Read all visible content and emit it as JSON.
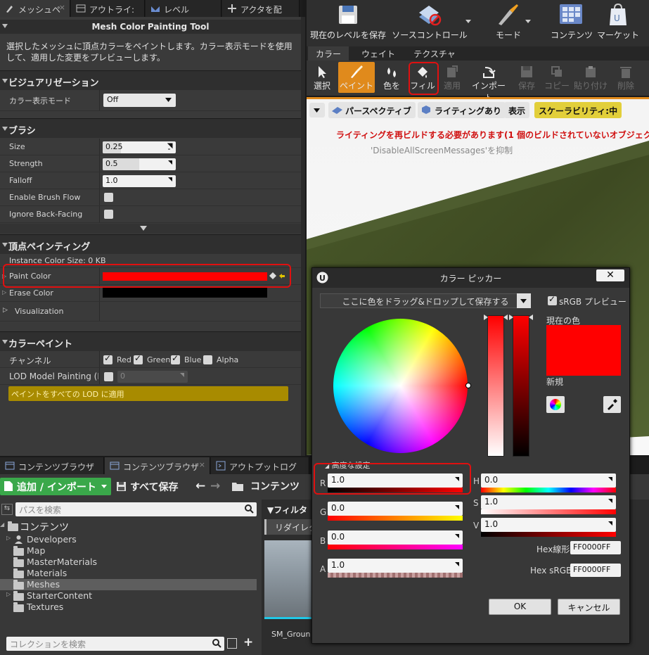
{
  "left_tabs": [
    {
      "label": "メッシュペ",
      "icon": "paint-brush-icon"
    },
    {
      "label": "アウトライ:",
      "icon": "outliner-icon"
    },
    {
      "label": "レベル",
      "icon": "level-icon"
    },
    {
      "label": "アクタを配",
      "icon": "place-actor-icon"
    }
  ],
  "tool": {
    "title": "Mesh Color Painting Tool",
    "description_line1": "選択したメッシュに頂点カラーをペイントします。カラー表示モードを使用",
    "description_line2": "して、適用した変更をプレビューします。"
  },
  "visualization": {
    "header": "ビジュアリゼーション",
    "color_view_label": "カラー表示モード",
    "color_view_value": "Off"
  },
  "brush": {
    "header": "ブラシ",
    "size_label": "Size",
    "size_value": "0.25",
    "strength_label": "Strength",
    "strength_value": "0.5",
    "falloff_label": "Falloff",
    "falloff_value": "1.0",
    "flow_label": "Enable Brush Flow",
    "backface_label": "Ignore Back-Facing"
  },
  "vertex": {
    "header": "頂点ペインティング",
    "instance_size": "Instance Color Size: 0 KB",
    "paint_color_label": "Paint Color",
    "paint_color": "#ff0000",
    "erase_color_label": "Erase Color",
    "erase_color": "#000000",
    "visualization_label": "Visualization"
  },
  "color_paint": {
    "header": "カラーペイント",
    "channel_label": "チャンネル",
    "channels": [
      "Red",
      "Green",
      "Blue",
      "Alpha"
    ],
    "lod_label": "LOD Model Painting (LO",
    "lod_value": "0",
    "apply_all_lod": "ペイントをすべての LOD に適用"
  },
  "top_toolbar": [
    {
      "label": "現在のレベルを保存",
      "icon": "save-disk-icon"
    },
    {
      "label": "ソースコントロール",
      "icon": "source-control-icon"
    },
    {
      "label": "モード",
      "icon": "modes-icon"
    },
    {
      "label": "コンテンツ",
      "icon": "content-icon"
    },
    {
      "label": "マーケット",
      "icon": "marketplace-icon"
    }
  ],
  "mode_tabs": [
    "カラー",
    "ウェイト",
    "テクスチャ"
  ],
  "paint_tools": [
    {
      "label": "選択",
      "icon": "select-cursor-icon"
    },
    {
      "label": "ペイント",
      "icon": "paint-brush-icon"
    },
    {
      "label": "色を",
      "icon": "swap-colors-icon"
    },
    {
      "label": "フィル",
      "icon": "fill-bucket-icon"
    },
    {
      "label": "適用",
      "icon": "apply-icon"
    },
    {
      "label": "インポート",
      "icon": "import-icon"
    },
    {
      "label": "保存",
      "icon": "save-icon"
    },
    {
      "label": "コピー",
      "icon": "copy-icon"
    },
    {
      "label": "貼り付け",
      "icon": "paste-icon"
    },
    {
      "label": "削除",
      "icon": "delete-icon"
    }
  ],
  "viewport": {
    "perspective": "パースペクティブ",
    "lighting": "ライティングあり",
    "show": "表示",
    "scalability": "スケーラビリティ:中",
    "warning": "ライティングを再ビルドする必要があります(1 個のビルドされていないオブジェク",
    "suppress": "'DisableAllScreenMessages'を抑制"
  },
  "color_picker": {
    "title": "カラー ピッカー",
    "drop_hint": "ここに色をドラッグ&ドロップして保存する",
    "srgb_preview": "sRGB プレビュー",
    "current_label": "現在の色",
    "new_label": "新規",
    "current_color": "#ff0000",
    "advanced": "高度な設定",
    "r_label": "R",
    "r_value": "1.0",
    "g_label": "G",
    "g_value": "0.0",
    "b_label": "B",
    "b_value": "0.0",
    "a_label": "A",
    "a_value": "1.0",
    "h_label": "H",
    "h_value": "0.0",
    "s_label": "S",
    "s_value": "1.0",
    "v_label": "V",
    "v_value": "1.0",
    "hex_linear_label": "Hex線形",
    "hex_linear": "FF0000FF",
    "hex_srgb_label": "Hex sRGB",
    "hex_srgb": "FF0000FF",
    "ok": "OK",
    "cancel": "キャンセル"
  },
  "bottom_tabs": [
    {
      "label": "コンテンツブラウザ",
      "icon": "content-browser-icon"
    },
    {
      "label": "コンテンツブラウザ",
      "icon": "content-browser-icon"
    },
    {
      "label": "アウトプットログ",
      "icon": "output-log-icon"
    }
  ],
  "content_browser": {
    "add_import": "追加 / インポート",
    "save_all": "すべて保存",
    "path": "コンテンツ",
    "search_path": "パスを検索",
    "root": "コンテンツ",
    "folders": [
      "Developers",
      "Map",
      "MasterMaterials",
      "Materials",
      "Meshes",
      "StarterContent",
      "Textures"
    ],
    "filter": "フィルタ",
    "redirect": "リダイレク",
    "asset_name": "SM_Groun",
    "search_collections": "コレクションを検索"
  }
}
